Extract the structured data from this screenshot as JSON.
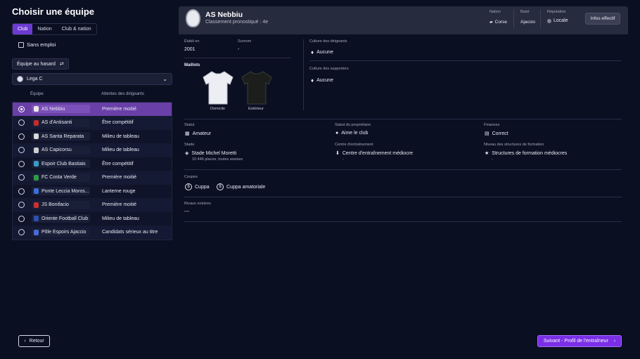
{
  "page_title": "Choisir une équipe",
  "tabs": [
    {
      "label": "Club",
      "active": true
    },
    {
      "label": "Nation",
      "active": false
    },
    {
      "label": "Club & nation",
      "active": false
    }
  ],
  "unemployed_label": "Sans emploi",
  "random_team_label": "Équipe au hasard",
  "league_select": {
    "value": "Lega C"
  },
  "table": {
    "headers": [
      "Équipe",
      "Attentes des dirigeants"
    ],
    "rows": [
      {
        "club": "AS Nebbiu",
        "expectation": "Première moitié",
        "selected": true,
        "crest_color": "#e8e8e8"
      },
      {
        "club": "AS d'Antisanti",
        "expectation": "Être compétitif",
        "selected": false,
        "crest_color": "#c42b2b"
      },
      {
        "club": "AS Santa Reparata",
        "expectation": "Milieu de tableau",
        "selected": false,
        "crest_color": "#d9d9d9"
      },
      {
        "club": "AS Capicorsu",
        "expectation": "Milieu de tableau",
        "selected": false,
        "crest_color": "#cfcfcf"
      },
      {
        "club": "Espoir Club Bastiais",
        "expectation": "Être compétitif",
        "selected": false,
        "crest_color": "#3a9bc8"
      },
      {
        "club": "FC Costa Verde",
        "expectation": "Première moitié",
        "selected": false,
        "crest_color": "#2f9b45"
      },
      {
        "club": "Ponte Leccia Moros...",
        "expectation": "Lanterne rouge",
        "selected": false,
        "crest_color": "#3a6fd8"
      },
      {
        "club": "JS Bonifacio",
        "expectation": "Première moitié",
        "selected": false,
        "crest_color": "#c8322f"
      },
      {
        "club": "Oriente Football Club",
        "expectation": "Milieu de tableau",
        "selected": false,
        "crest_color": "#2d4fb0"
      },
      {
        "club": "Pôle Espoirs Ajaccio",
        "expectation": "Candidats sérieux au titre",
        "selected": false,
        "crest_color": "#4a6ad8"
      }
    ]
  },
  "club": {
    "name": "AS Nebbiu",
    "predicted": "Classement pronostiqué : 4e",
    "nation_label": "Nation",
    "nation_value": "Corse",
    "based_label": "Basé",
    "based_value": "Ajaccio",
    "reputation_label": "Réputation",
    "reputation_value": "Locale",
    "squad_info_button": "Infos effectif",
    "founded_label": "Établi en",
    "founded_value": "2001",
    "nickname_label": "Surnom",
    "nickname_value": "-",
    "kits_label": "Maillots",
    "kit_home_label": "Domicile",
    "kit_away_label": "Extérieur",
    "board_culture_label": "Culture des dirigeants",
    "board_culture_value": "Aucune",
    "supporters_culture_label": "Culture des supporters",
    "supporters_culture_value": "Aucune",
    "status_label": "Statut",
    "status_value": "Amateur",
    "owner_label": "Statut du propriétaire",
    "owner_value": "Aime le club",
    "finances_label": "Finances",
    "finances_value": "Correct",
    "stadium_label": "Stade",
    "stadium_value": "Stade Michel Moretti",
    "stadium_capacity": "10 446 places, toutes assises",
    "training_label": "Centre d'entraînement",
    "training_value": "Centre d'entraînement médiocre",
    "training_sub": "-",
    "youth_label": "Niveau des structures de formation",
    "youth_value": "Structures de formation médiocres",
    "youth_sub": "-",
    "cups_label": "Coupes",
    "cups": [
      "Cuppa",
      "Cuppa amatoriale"
    ],
    "rivals_label": "Rivaux notoires",
    "rivals_value": "---"
  },
  "footer": {
    "back_label": "Retour",
    "next_label": "Suivant - Profil de l'entraîneur"
  }
}
